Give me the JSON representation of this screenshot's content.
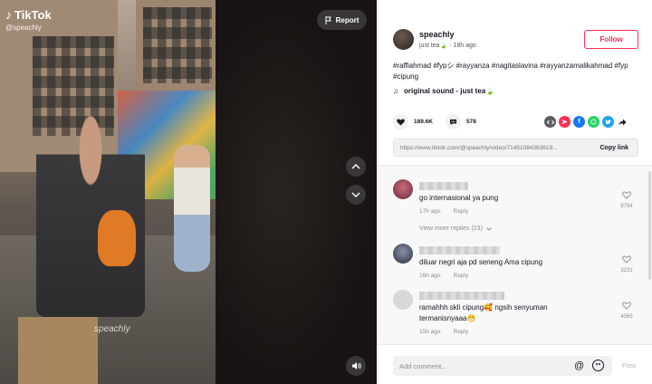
{
  "app": {
    "logo_text": "TikTok",
    "handle_overlay": "@speachly",
    "watermark": "speachly"
  },
  "video": {
    "report_label": "Report"
  },
  "author": {
    "name": "speachly",
    "subtitle": "just tea🍃 · 18h ago",
    "follow_label": "Follow"
  },
  "caption": {
    "text": "#raffiahmad #fypシ #rayyanza #nagitaslavina #rayyanzamalikahmad #fyp #cipung"
  },
  "sound": {
    "label": "original sound - just tea🍃"
  },
  "stats": {
    "likes": "189.6K",
    "comments": "578"
  },
  "share": {
    "icons": [
      "embed-icon",
      "send-icon",
      "facebook-icon",
      "whatsapp-icon",
      "twitter-icon",
      "forward-icon"
    ]
  },
  "link": {
    "url": "https://www.tiktok.com/@speachly/video/71451084363619...",
    "copy_label": "Copy link"
  },
  "comments": [
    {
      "text": "go internasional ya pung",
      "time": "17h ago",
      "reply": "Reply",
      "likes": "8784"
    },
    {
      "text": "diluar negri aja pd seneng Ama cipung",
      "time": "16h ago",
      "reply": "Reply",
      "likes": "3231"
    },
    {
      "text_line1": "ramahhh skli cipung🥰 ngsih senyuman",
      "text_line2": "termanisnyaaa😁",
      "time": "15h ago",
      "reply": "Reply",
      "likes": "4065"
    }
  ],
  "view_more": "View more replies (23)",
  "footer": {
    "placeholder": "Add comment...",
    "post_label": "Post"
  },
  "colors": {
    "accent": "#fe2c55",
    "text": "#161823",
    "muted": "#8a8b91"
  }
}
